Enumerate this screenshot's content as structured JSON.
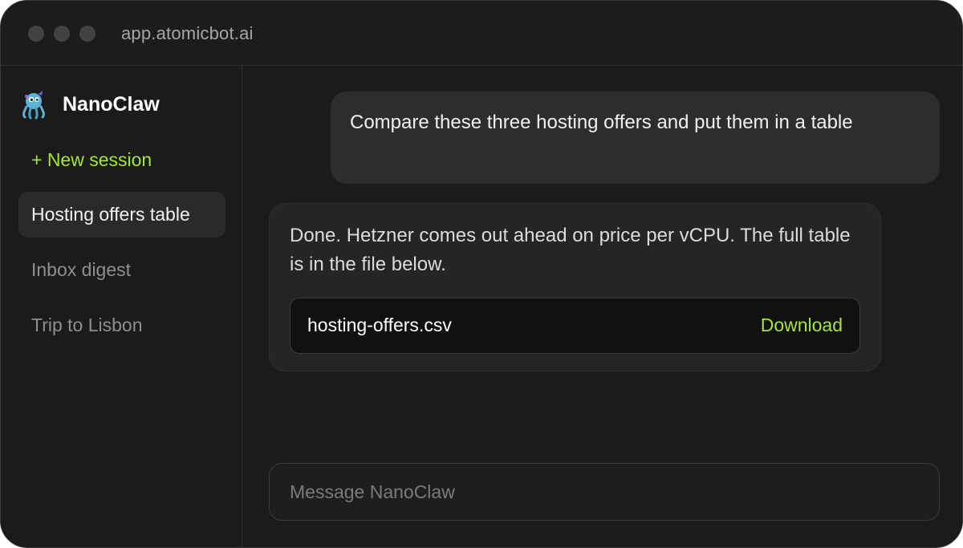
{
  "window": {
    "url": "app.atomicbot.ai",
    "traffic_lights": [
      "close",
      "minimize",
      "maximize"
    ]
  },
  "sidebar": {
    "brand_name": "NanoClaw",
    "brand_icon": "nanoclaw-octopus-logo",
    "new_session_label": "+ New session",
    "sessions": [
      {
        "label": "Hosting offers table",
        "active": true
      },
      {
        "label": "Inbox digest",
        "active": false
      },
      {
        "label": "Trip to Lisbon",
        "active": false
      }
    ]
  },
  "chat": {
    "user_message": "Compare these three hosting offers and put them in a table",
    "assistant_message": "Done. Hetzner comes out ahead on price per vCPU. The full table is in the file below.",
    "attachment": {
      "file_name": "hosting-offers.csv",
      "action_label": "Download"
    }
  },
  "composer": {
    "placeholder": "Message NanoClaw",
    "value": ""
  },
  "colors": {
    "accent": "#a3e635",
    "background": "#1b1b1b",
    "bubble": "#2d2d2d"
  }
}
